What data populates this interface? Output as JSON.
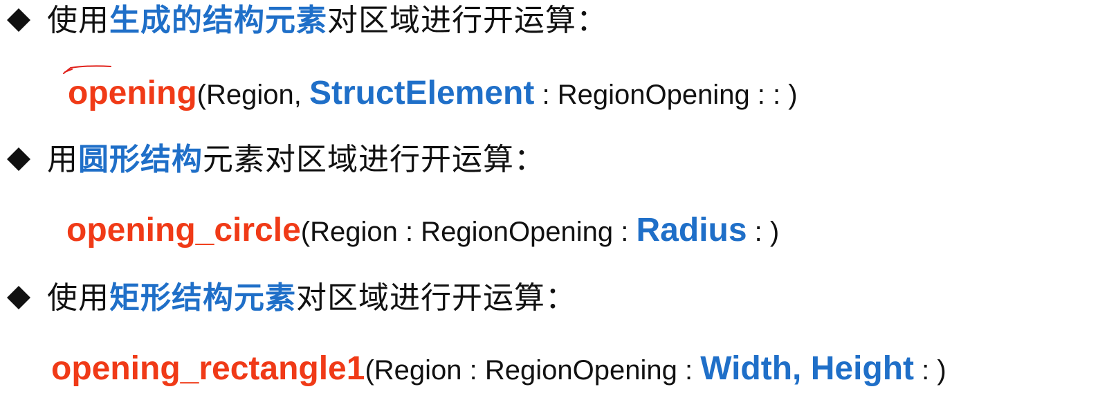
{
  "items": [
    {
      "heading": {
        "prefix": "使用",
        "highlight": "生成的结构元素",
        "suffix": "对区域进行开运算："
      },
      "code": {
        "fn": "opening",
        "part1": "(Region, ",
        "param": "StructElement",
        "part2": " : RegionOpening : : )"
      }
    },
    {
      "heading": {
        "prefix": "用",
        "highlight": "圆形结构",
        "suffix": "元素对区域进行开运算："
      },
      "code": {
        "fn": "opening_circle",
        "part1": "(Region : RegionOpening : ",
        "param": "Radius",
        "part2": " : )"
      }
    },
    {
      "heading": {
        "prefix": "使用",
        "highlight": "矩形结构元素",
        "suffix": "对区域进行开运算："
      },
      "code": {
        "fn": "opening_rectangle1",
        "part1": "(Region : RegionOpening : ",
        "param": "Width, Height",
        "part2": " : )"
      }
    }
  ],
  "colors": {
    "highlight": "#1f6fc8",
    "function": "#f03a17",
    "text": "#111111",
    "bullet": "#111111"
  },
  "icons": {
    "bullet": "diamond-bullet-icon",
    "annotation": "pen-annotation-icon"
  }
}
